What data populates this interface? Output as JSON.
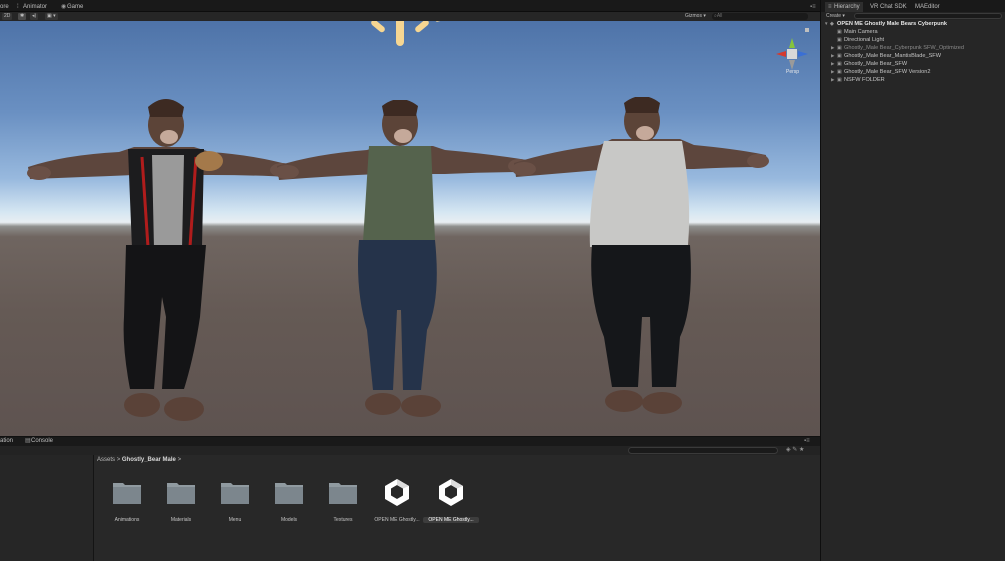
{
  "topbar": {
    "tabs": [
      {
        "label": "ore",
        "icon": ""
      },
      {
        "label": "Animator",
        "icon": "animator-icon"
      },
      {
        "label": "Game",
        "icon": "game-icon"
      }
    ]
  },
  "scene": {
    "toolbar": {
      "mode_2d": "2D",
      "gizmos": "Gizmos ▾",
      "search_placeholder": "All"
    },
    "persp_label": "Persp",
    "sky_top_color": "#4e73a8",
    "ground_color": "#655a55"
  },
  "bottom": {
    "tabs": [
      {
        "label": "ation"
      },
      {
        "label": "Console"
      }
    ],
    "breadcrumb": {
      "root": "Assets",
      "sep": ">",
      "current": "Ghostly_Bear Male",
      "trail": ">"
    },
    "assets": [
      {
        "label": "Animations",
        "icon": "folder-icon"
      },
      {
        "label": "Materials",
        "icon": "folder-icon"
      },
      {
        "label": "Menu",
        "icon": "folder-icon"
      },
      {
        "label": "Models",
        "icon": "folder-icon"
      },
      {
        "label": "Textures",
        "icon": "folder-icon"
      },
      {
        "label": "OPEN ME Ghostly...",
        "icon": "unity-scene-icon"
      },
      {
        "label": "OPEN ME Ghostly...",
        "icon": "unity-scene-icon",
        "selected": true
      }
    ]
  },
  "hierarchy": {
    "tabs": [
      {
        "label": "Hierarchy"
      },
      {
        "label": "VR Chat SDK"
      },
      {
        "label": "MAEditor"
      }
    ],
    "create_label": "Create ▾",
    "search_placeholder": "All",
    "root": "OPEN ME Ghostly Male Bears Cyberpunk",
    "items": [
      {
        "label": "Main Camera",
        "expandable": false,
        "dim": false
      },
      {
        "label": "Directional Light",
        "expandable": false,
        "dim": false
      },
      {
        "label": "Ghostly_Male Bear_Cyberpunk SFW_Optimized",
        "expandable": true,
        "dim": true
      },
      {
        "label": "Ghostly_Male Bear_MantisBlade_SFW",
        "expandable": true,
        "dim": false
      },
      {
        "label": "Ghostly_Male Bear_SFW",
        "expandable": true,
        "dim": false
      },
      {
        "label": "Ghostly_Male Bear_SFW Version2",
        "expandable": true,
        "dim": false
      },
      {
        "label": "NSFW FOLDER",
        "expandable": true,
        "dim": false
      }
    ]
  }
}
